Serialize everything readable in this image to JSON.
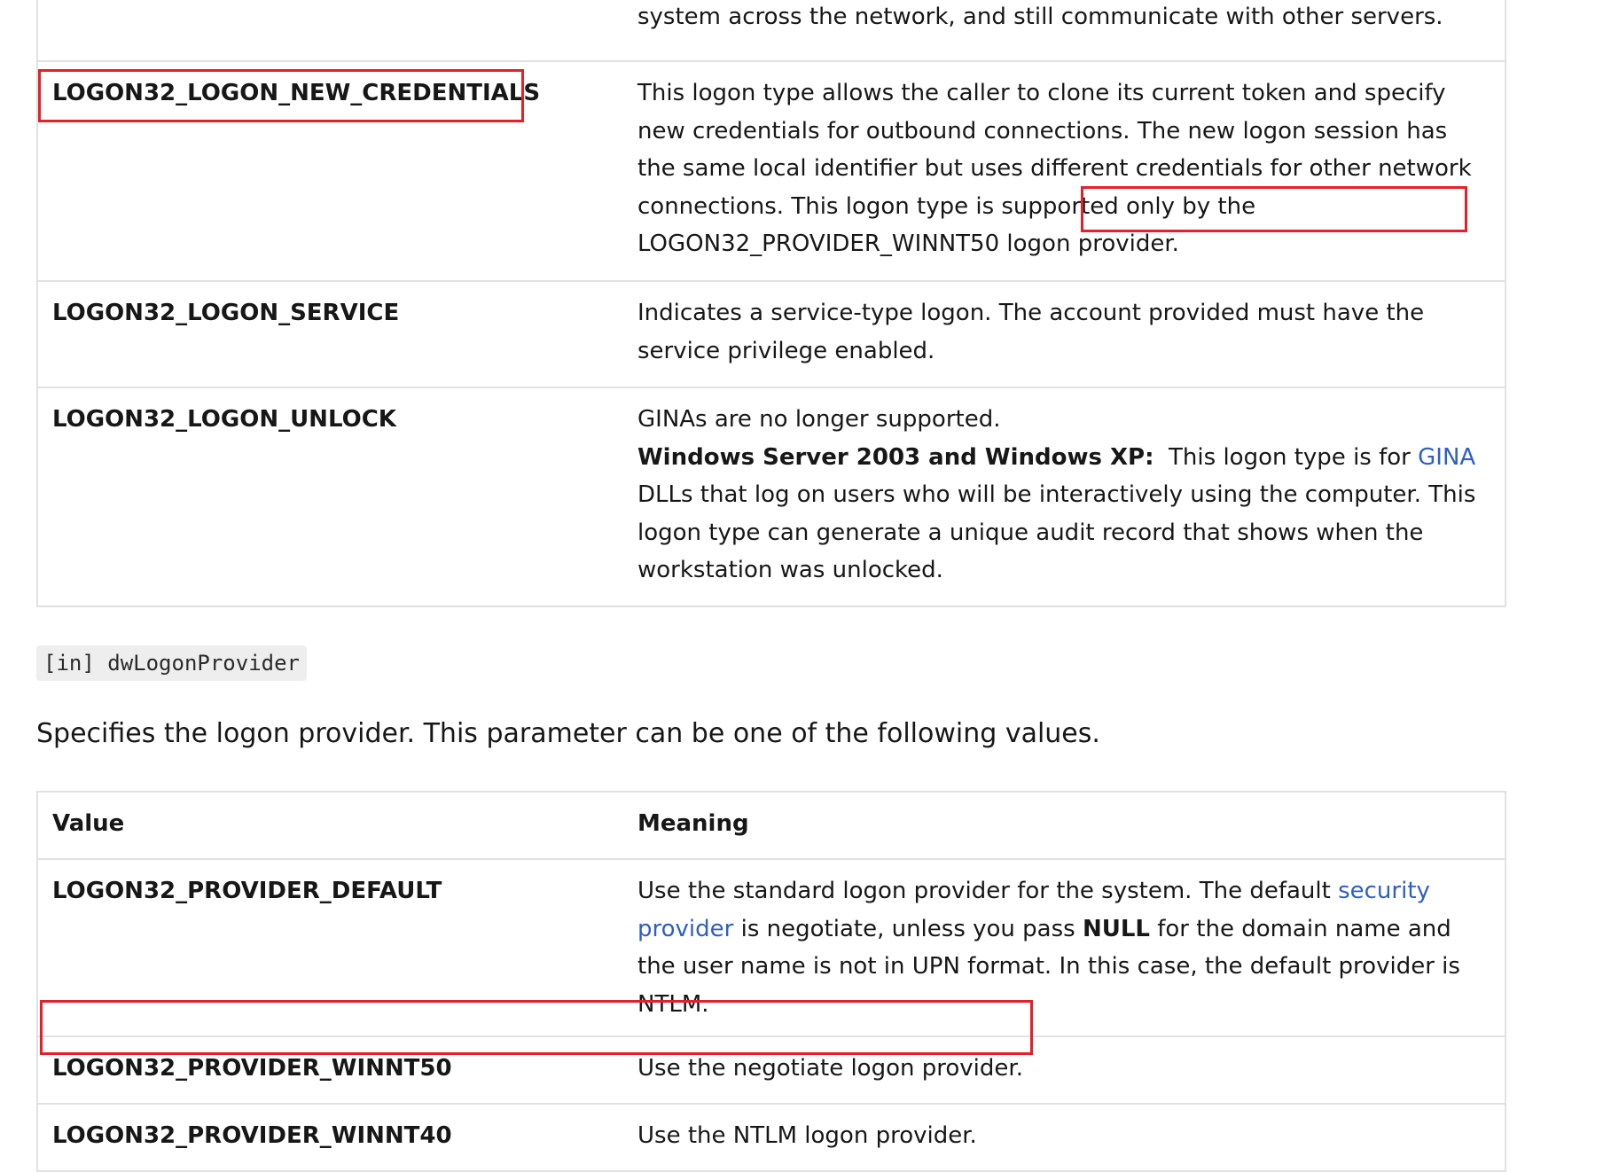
{
  "logon_types_table": {
    "rows": [
      {
        "value": "",
        "meaning": "system across the network, and still communicate with other servers."
      },
      {
        "value": "LOGON32_LOGON_NEW_CREDENTIALS",
        "meaning_part1": "This logon type allows the caller to clone its current token and specify new credentials for outbound connections. The new logon session has the same local identifier but uses different credentials for other network connections. This logon type is supported only by the",
        "meaning_code": "LOGON32_PROVIDER_WINNT50",
        "meaning_part2": "logon provider."
      },
      {
        "value": "LOGON32_LOGON_SERVICE",
        "meaning": "Indicates a service-type logon. The account provided must have the service privilege enabled."
      },
      {
        "value": "LOGON32_LOGON_UNLOCK",
        "meaning_line1": "GINAs are no longer supported.",
        "meaning_bold": "Windows Server 2003 and Windows XP:",
        "meaning_pre_link": "This logon type is for",
        "meaning_link": "GINA",
        "meaning_post_link": "DLLs that log on users who will be interactively using the computer. This logon type can generate a unique audit record that shows when the workstation was unlocked."
      }
    ]
  },
  "param": {
    "code": "[in] dwLogonProvider",
    "description": "Specifies the logon provider. This parameter can be one of the following values."
  },
  "providers_table": {
    "headers": {
      "value": "Value",
      "meaning": "Meaning"
    },
    "rows": [
      {
        "value": "LOGON32_PROVIDER_DEFAULT",
        "meaning_pre_link": "Use the standard logon provider for the system. The default",
        "meaning_link": "security provider",
        "meaning_mid": "is negotiate, unless you pass",
        "meaning_bold": "NULL",
        "meaning_post": "for the domain name and the user name is not in UPN format. In this case, the default provider is NTLM."
      },
      {
        "value": "LOGON32_PROVIDER_WINNT50",
        "meaning": "Use the negotiate logon provider."
      },
      {
        "value": "LOGON32_PROVIDER_WINNT40",
        "meaning": "Use the NTLM logon provider."
      }
    ]
  },
  "colors": {
    "link": "#2f5ec4",
    "highlight_box": "#e3202a",
    "table_border": "#e1e1e1",
    "code_background": "#eeeeee"
  }
}
